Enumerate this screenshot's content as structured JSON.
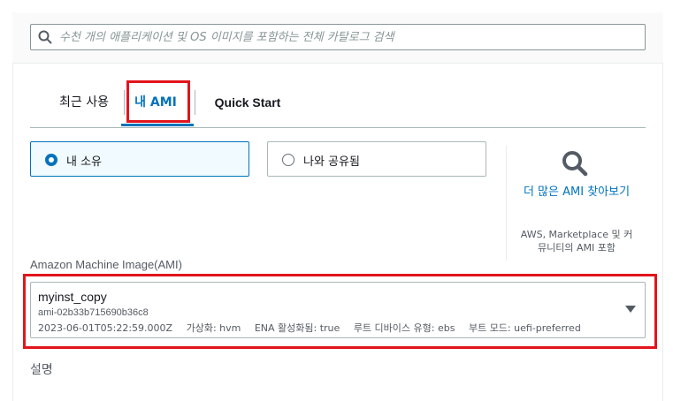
{
  "search": {
    "placeholder": "수천 개의 애플리케이션 및 OS 이미지를 포함하는 전체 카탈로그 검색",
    "icon": "search-icon"
  },
  "tabs": [
    {
      "label": "최근 사용",
      "active": false
    },
    {
      "label": "내 AMI",
      "active": true
    },
    {
      "label": "Quick Start",
      "active": false
    }
  ],
  "ownership": {
    "options": [
      {
        "label": "내 소유",
        "selected": true
      },
      {
        "label": "나와 공유됨",
        "selected": false
      }
    ]
  },
  "browse_more": {
    "link": "더 많은 AMI 찾아보기",
    "description": "AWS, Marketplace 및 커뮤니티의 AMI 포함"
  },
  "ami_field": {
    "label": "Amazon Machine Image(AMI)",
    "selected": {
      "name": "myinst_copy",
      "id": "ami-02b33b715690b36c8",
      "created": "2023-06-01T05:22:59.000Z",
      "virtualization": "가상화: hvm",
      "ena": "ENA 활성화됨: true",
      "root_device": "루트 디바이스 유형: ebs",
      "boot_mode": "부트 모드: uefi-preferred"
    }
  },
  "description_label": "설명",
  "colors": {
    "accent": "#0073bb",
    "highlight": "#e3141c"
  }
}
